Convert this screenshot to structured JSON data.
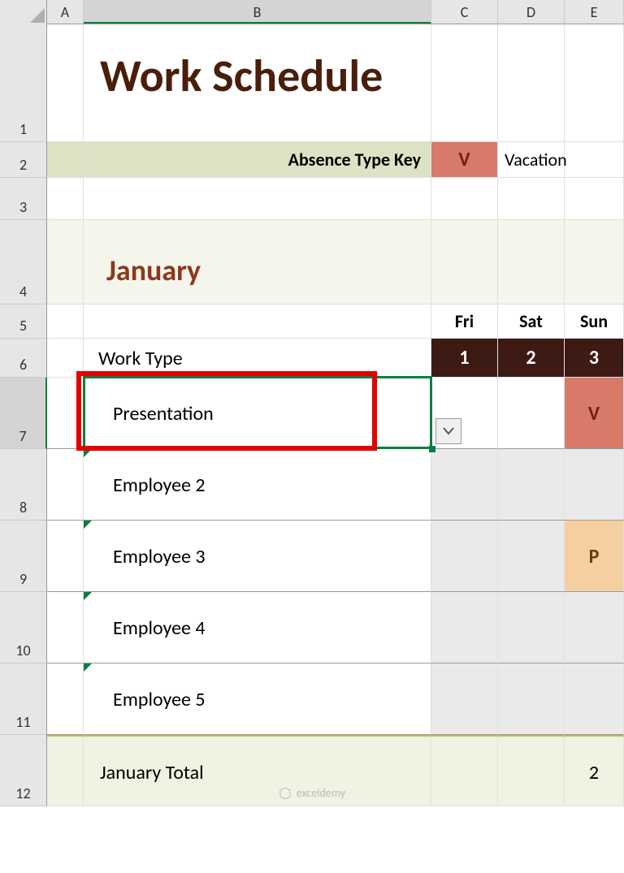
{
  "columns": [
    "A",
    "B",
    "C",
    "D",
    "E"
  ],
  "rows": [
    "1",
    "2",
    "3",
    "4",
    "5",
    "6",
    "7",
    "8",
    "9",
    "10",
    "11",
    "12"
  ],
  "title": "Work Schedule",
  "key": {
    "label": "Absence Type Key",
    "code": "V",
    "name": "Vacation"
  },
  "month": "January",
  "days": {
    "headers": [
      "Fri",
      "Sat",
      "Sun"
    ],
    "nums": [
      "1",
      "2",
      "3"
    ]
  },
  "worktype_label": "Work Type",
  "selected_value": "Presentation",
  "employees": [
    "Employee 2",
    "Employee 3",
    "Employee 4",
    "Employee 5"
  ],
  "cells": {
    "e7": "V",
    "e9": "P"
  },
  "total": {
    "label": "January Total",
    "e": "2"
  },
  "watermark": "exceldemy"
}
